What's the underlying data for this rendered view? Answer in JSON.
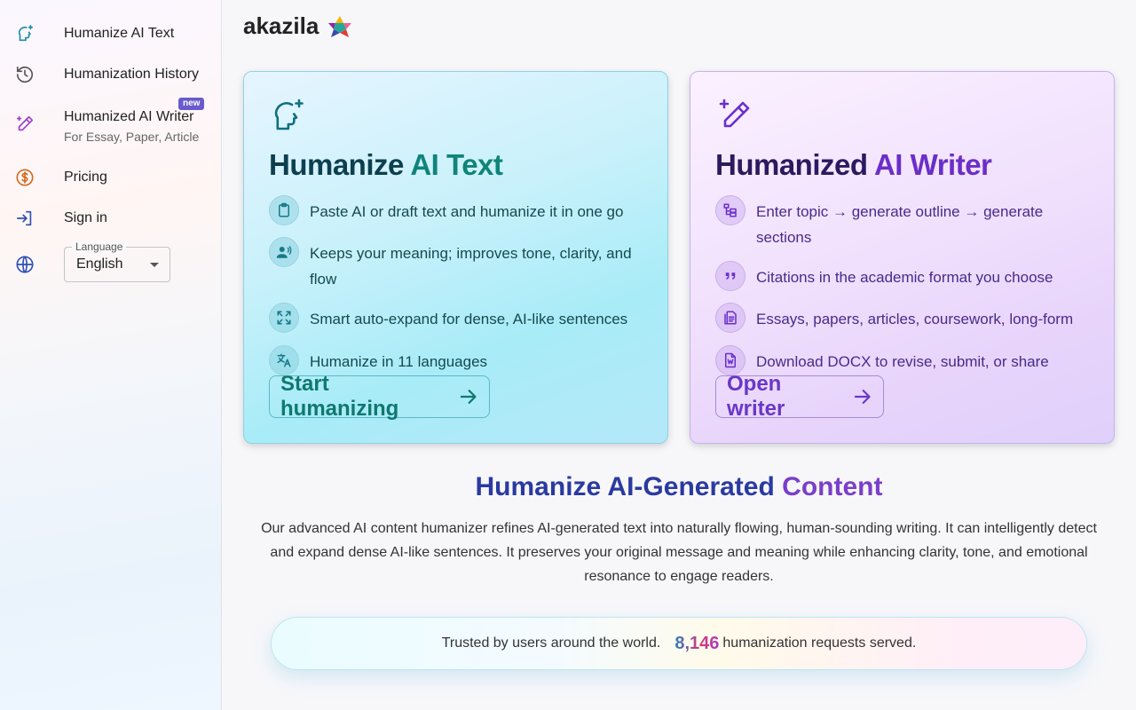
{
  "sidebar": {
    "items": [
      {
        "label": "Humanize AI Text",
        "icon": "head-sparkle-icon",
        "color": "#1a8fa0"
      },
      {
        "label": "Humanization History",
        "icon": "history-icon",
        "color": "#555555"
      },
      {
        "label": "Humanized AI Writer",
        "sub": "For Essay, Paper, Article",
        "badge": "new",
        "icon": "pen-sparkle-icon",
        "color": "#9b3fc9"
      },
      {
        "label": "Pricing",
        "icon": "dollar-icon",
        "color": "#d2691e"
      },
      {
        "label": "Sign in",
        "icon": "login-icon",
        "color": "#2d4fb5"
      }
    ],
    "language": {
      "legend": "Language",
      "value": "English",
      "icon": "globe-icon"
    }
  },
  "brand": {
    "name": "akazila",
    "logo": "multicolor-star-logo"
  },
  "cards": {
    "humanize": {
      "title_part1": "Humanize ",
      "title_part2": "AI Text",
      "features": [
        {
          "icon": "clipboard-icon",
          "text": "Paste AI or draft text and humanize it in one go"
        },
        {
          "icon": "person-voice-icon",
          "text": "Keeps your meaning; improves tone, clarity, and flow"
        },
        {
          "icon": "expand-icon",
          "text": "Smart auto-expand for dense, AI-like sentences"
        },
        {
          "icon": "translate-icon",
          "text": "Humanize in 11 languages"
        }
      ],
      "button": "Start humanizing"
    },
    "writer": {
      "title_part1": "Humanized ",
      "title_part2": "AI Writer",
      "features": [
        {
          "icon": "outline-icon",
          "text": "Enter topic → generate outline → generate sections"
        },
        {
          "icon": "quote-icon",
          "text": "Citations in the academic format you choose"
        },
        {
          "icon": "document-icon",
          "text": "Essays, papers, articles, coursework, long-form"
        },
        {
          "icon": "word-file-icon",
          "text": "Download DOCX to revise, submit, or share"
        }
      ],
      "button": "Open writer"
    }
  },
  "section": {
    "title_part1": "Humanize AI-Generated ",
    "title_part2": "Content",
    "description": "Our advanced AI content humanizer refines AI-generated text into naturally flowing, human-sounding writing. It can intelligently detect and expand dense AI-like sentences. It preserves your original message and meaning while enhancing clarity, tone, and emotional resonance to engage readers."
  },
  "trust": {
    "prefix": "Trusted by users around the world.",
    "count": "8,146",
    "suffix": "humanization requests served."
  }
}
